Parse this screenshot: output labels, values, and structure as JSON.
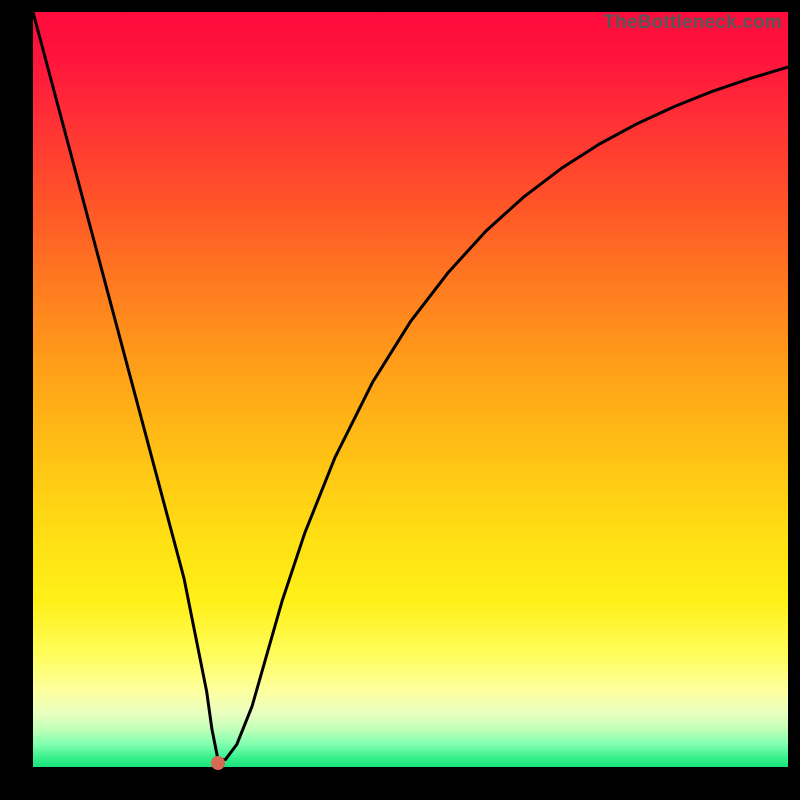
{
  "watermark": "TheBottleneck.com",
  "chart_data": {
    "type": "line",
    "title": "",
    "xlabel": "",
    "ylabel": "",
    "xlim": [
      0,
      100
    ],
    "ylim": [
      0,
      100
    ],
    "series": [
      {
        "name": "curve",
        "x": [
          0,
          2,
          4,
          6,
          8,
          10,
          12,
          14,
          16,
          18,
          20,
          21,
          22,
          23,
          23.7,
          24.5,
          25.5,
          27,
          29,
          31,
          33,
          36,
          40,
          45,
          50,
          55,
          60,
          65,
          70,
          75,
          80,
          85,
          90,
          95,
          100
        ],
        "y": [
          100,
          92.5,
          85,
          77.5,
          70,
          62.5,
          55,
          47.5,
          40,
          32.5,
          25,
          20,
          15,
          10,
          5,
          1,
          1,
          3,
          8,
          15,
          22,
          31,
          41,
          51,
          59,
          65.5,
          71,
          75.5,
          79.3,
          82.5,
          85.2,
          87.5,
          89.5,
          91.2,
          92.7
        ]
      }
    ],
    "marker": {
      "x": 24.5,
      "y": 0.5,
      "color": "#d56a55"
    },
    "background_gradient": {
      "top": "#ff0a3c",
      "mid": "#ffc514",
      "bottom": "#18e37a"
    }
  }
}
